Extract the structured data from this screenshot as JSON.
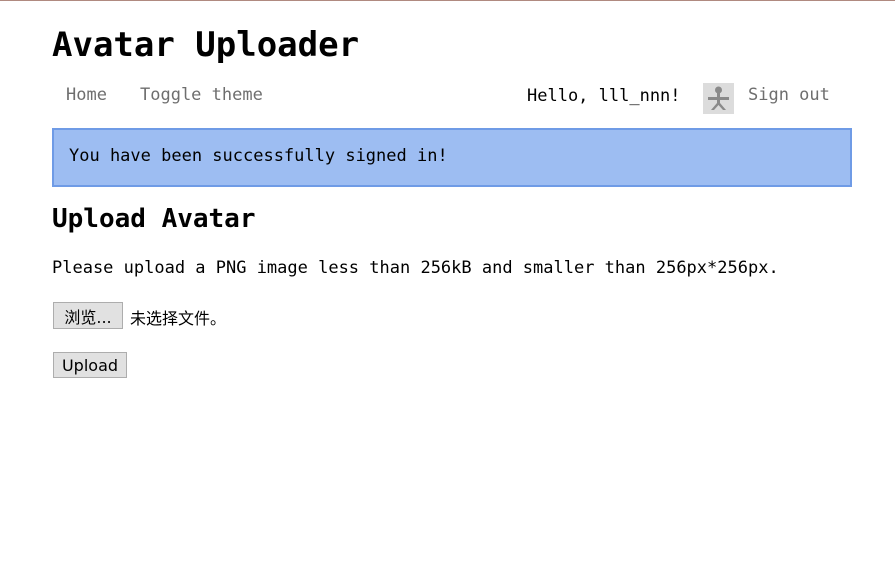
{
  "header": {
    "title": "Avatar Uploader"
  },
  "nav": {
    "home_label": "Home",
    "theme_label": "Toggle theme",
    "greeting": "Hello, lll_nnn!",
    "signout_label": "Sign out"
  },
  "alert": {
    "message": "You have been successfully signed in!"
  },
  "upload": {
    "heading": "Upload Avatar",
    "instructions": "Please upload a PNG image less than 256kB and smaller than 256px*256px.",
    "browse_label": "浏览...",
    "file_status": "未选择文件。",
    "submit_label": "Upload"
  },
  "colors": {
    "alert_background": "#9dbdf2",
    "alert_border": "#6f9be6",
    "nav_link": "#6e6e6e"
  }
}
